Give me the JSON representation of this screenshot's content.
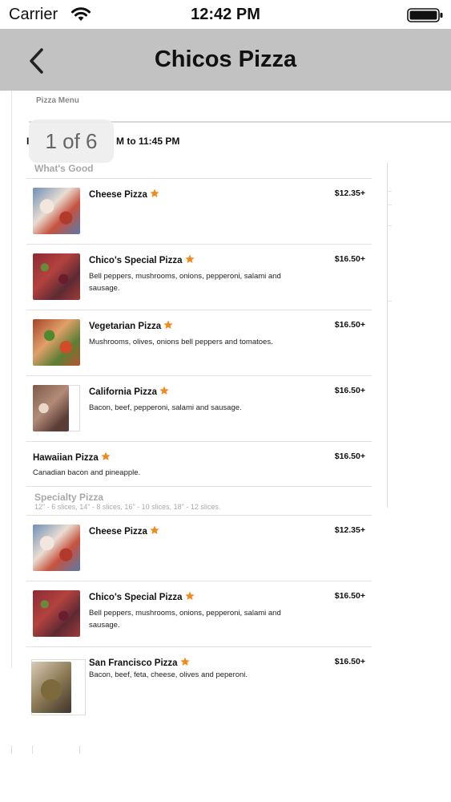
{
  "status_bar": {
    "carrier": "Carrier",
    "time": "12:42 PM"
  },
  "nav": {
    "title": "Chicos Pizza",
    "back_icon": "chevron-left-icon"
  },
  "document": {
    "heading": "Pizza Menu",
    "hours_prefix": "I",
    "hours": "M to 11:45 PM",
    "page_indicator": "1 of 6",
    "sections": [
      {
        "title": "What's Good",
        "subtitle": ""
      },
      {
        "title": "Specialty Pizza",
        "subtitle": "12\" - 6 slices, 14\" - 8 slices, 16\" - 10 slices, 18\" - 12 slices."
      }
    ],
    "items": [
      {
        "name": "Cheese Pizza",
        "desc": "",
        "price": "$12.35+"
      },
      {
        "name": "Chico's Special Pizza",
        "desc": "Bell peppers, mushrooms, onions, pepperoni, salami and sausage.",
        "price": "$16.50+"
      },
      {
        "name": "Vegetarian Pizza",
        "desc": "Mushrooms, olives, onions bell peppers and tomatoes.",
        "price": "$16.50+"
      },
      {
        "name": "California Pizza",
        "desc": "Bacon, beef, pepperoni, salami and sausage.",
        "price": "$16.50+"
      },
      {
        "name": "Hawaiian Pizza",
        "desc": "Canadian bacon and pineapple.",
        "price": "$16.50+"
      },
      {
        "name": "Cheese Pizza",
        "desc": "",
        "price": "$12.35+"
      },
      {
        "name": "Chico's Special Pizza",
        "desc": "Bell peppers, mushrooms, onions, pepperoni, salami and sausage.",
        "price": "$16.50+"
      },
      {
        "name": "San Francisco Pizza",
        "desc": "Bacon, beef, feta, cheese, olives and peperoni.",
        "price": "$16.50+"
      }
    ],
    "colors": {
      "nav_bg": "#c2c2c2",
      "star": "#f08a1c",
      "section_text": "#a8a8a8"
    }
  }
}
